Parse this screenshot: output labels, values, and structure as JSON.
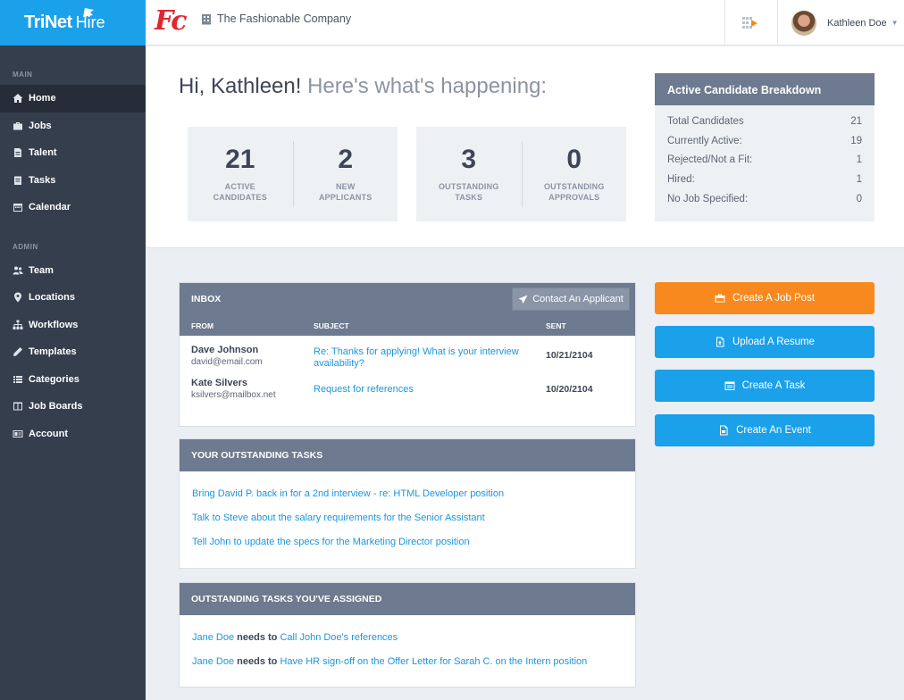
{
  "brand": {
    "name": "TriNet",
    "product": "Hire"
  },
  "topbar": {
    "company_logo": "Fc",
    "company_name": "The Fashionable Company",
    "user_name": "Kathleen Doe"
  },
  "sidebar": {
    "main_label": "MAIN",
    "admin_label": "ADMIN",
    "main_items": [
      {
        "label": "Home",
        "icon": "home-icon"
      },
      {
        "label": "Jobs",
        "icon": "briefcase-icon"
      },
      {
        "label": "Talent",
        "icon": "document-icon"
      },
      {
        "label": "Tasks",
        "icon": "checklist-icon"
      },
      {
        "label": "Calendar",
        "icon": "calendar-icon"
      }
    ],
    "admin_items": [
      {
        "label": "Team",
        "icon": "users-icon"
      },
      {
        "label": "Locations",
        "icon": "map-pin-icon"
      },
      {
        "label": "Workflows",
        "icon": "sitemap-icon"
      },
      {
        "label": "Templates",
        "icon": "pencil-icon"
      },
      {
        "label": "Categories",
        "icon": "list-icon"
      },
      {
        "label": "Job Boards",
        "icon": "board-icon"
      },
      {
        "label": "Account",
        "icon": "id-card-icon"
      }
    ]
  },
  "greeting": {
    "hi": "Hi, Kathleen!",
    "sub": "Here's what's happening:"
  },
  "stats": [
    {
      "value": "21",
      "label_1": "ACTIVE",
      "label_2": "CANDIDATES"
    },
    {
      "value": "2",
      "label_1": "NEW",
      "label_2": "APPLICANTS"
    },
    {
      "value": "3",
      "label_1": "OUTSTANDING",
      "label_2": "TASKS"
    },
    {
      "value": "0",
      "label_1": "OUTSTANDING",
      "label_2": "APPROVALS"
    }
  ],
  "breakdown": {
    "title": "Active Candidate Breakdown",
    "rows": [
      {
        "label": "Total Candidates",
        "value": "21"
      },
      {
        "label": "Currently Active:",
        "value": "19"
      },
      {
        "label": "Rejected/Not a Fit:",
        "value": "1"
      },
      {
        "label": "Hired:",
        "value": "1"
      },
      {
        "label": "No Job Specified:",
        "value": "0"
      }
    ]
  },
  "inbox": {
    "title": "INBOX",
    "contact_button": "Contact An Applicant",
    "columns": {
      "from": "FROM",
      "subject": "SUBJECT",
      "sent": "SENT"
    },
    "messages": [
      {
        "from": "Dave Johnson",
        "email": "david@email.com",
        "subject": "Re: Thanks for applying! What is your interview availability?",
        "sent": "10/21/2104"
      },
      {
        "from": "Kate Silvers",
        "email": "ksilvers@mailbox.net",
        "subject": "Request for references",
        "sent": "10/20/2104"
      }
    ]
  },
  "tasks": {
    "title": "YOUR OUTSTANDING TASKS",
    "items": [
      "Bring David P. back in for a 2nd interview - re: HTML Developer position",
      "Talk to Steve about the salary requirements for the Senior Assistant",
      "Tell John to update the specs for the Marketing Director position"
    ]
  },
  "assigned": {
    "title": "OUTSTANDING TASKS YOU'VE ASSIGNED",
    "items": [
      {
        "assignee": "Jane Doe",
        "needs": "needs to",
        "task": "Call John Doe's references"
      },
      {
        "assignee": "Jane Doe",
        "needs": "needs to",
        "task": "Have HR sign-off on the Offer Letter for Sarah C. on the Intern position"
      }
    ]
  },
  "actions": [
    {
      "label": "Create A Job Post",
      "icon": "briefcase-icon",
      "color": "#f7891f"
    },
    {
      "label": "Upload A Resume",
      "icon": "file-upload-icon",
      "color": "#1ba0ea"
    },
    {
      "label": "Create A Task",
      "icon": "calendar-list-icon",
      "color": "#1ba0ea"
    },
    {
      "label": "Create An Event",
      "icon": "file-event-icon",
      "color": "#1ba0ea"
    }
  ]
}
